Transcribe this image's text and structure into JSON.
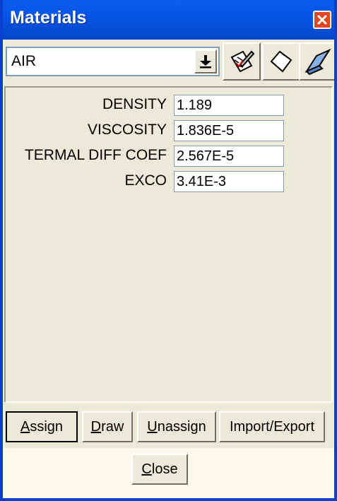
{
  "window": {
    "title": "Materials"
  },
  "material_select": {
    "value": "AIR"
  },
  "toolbar": {
    "icons": [
      "dropdown-arrow-icon",
      "edit-material-icon",
      "new-material-icon",
      "eraser-icon"
    ]
  },
  "properties": [
    {
      "label": "DENSITY",
      "value": "1.189"
    },
    {
      "label": "VISCOSITY",
      "value": "1.836E-5"
    },
    {
      "label": "TERMAL DIFF COEF",
      "value": "2.567E-5"
    },
    {
      "label": "EXCO",
      "value": "3.41E-3"
    }
  ],
  "buttons": {
    "assign": {
      "mnemonic": "A",
      "rest": "ssign"
    },
    "draw": {
      "mnemonic": "D",
      "rest": "raw"
    },
    "unassign": {
      "mnemonic": "U",
      "rest": "nassign"
    },
    "import_export": {
      "label": "Import/Export"
    },
    "close": {
      "mnemonic": "C",
      "rest": "lose"
    }
  },
  "colors": {
    "titlebar": "#0755e6",
    "window_bg": "#ece9d8",
    "footer_bg": "#fbf9ea",
    "close_button": "#e0481f"
  }
}
